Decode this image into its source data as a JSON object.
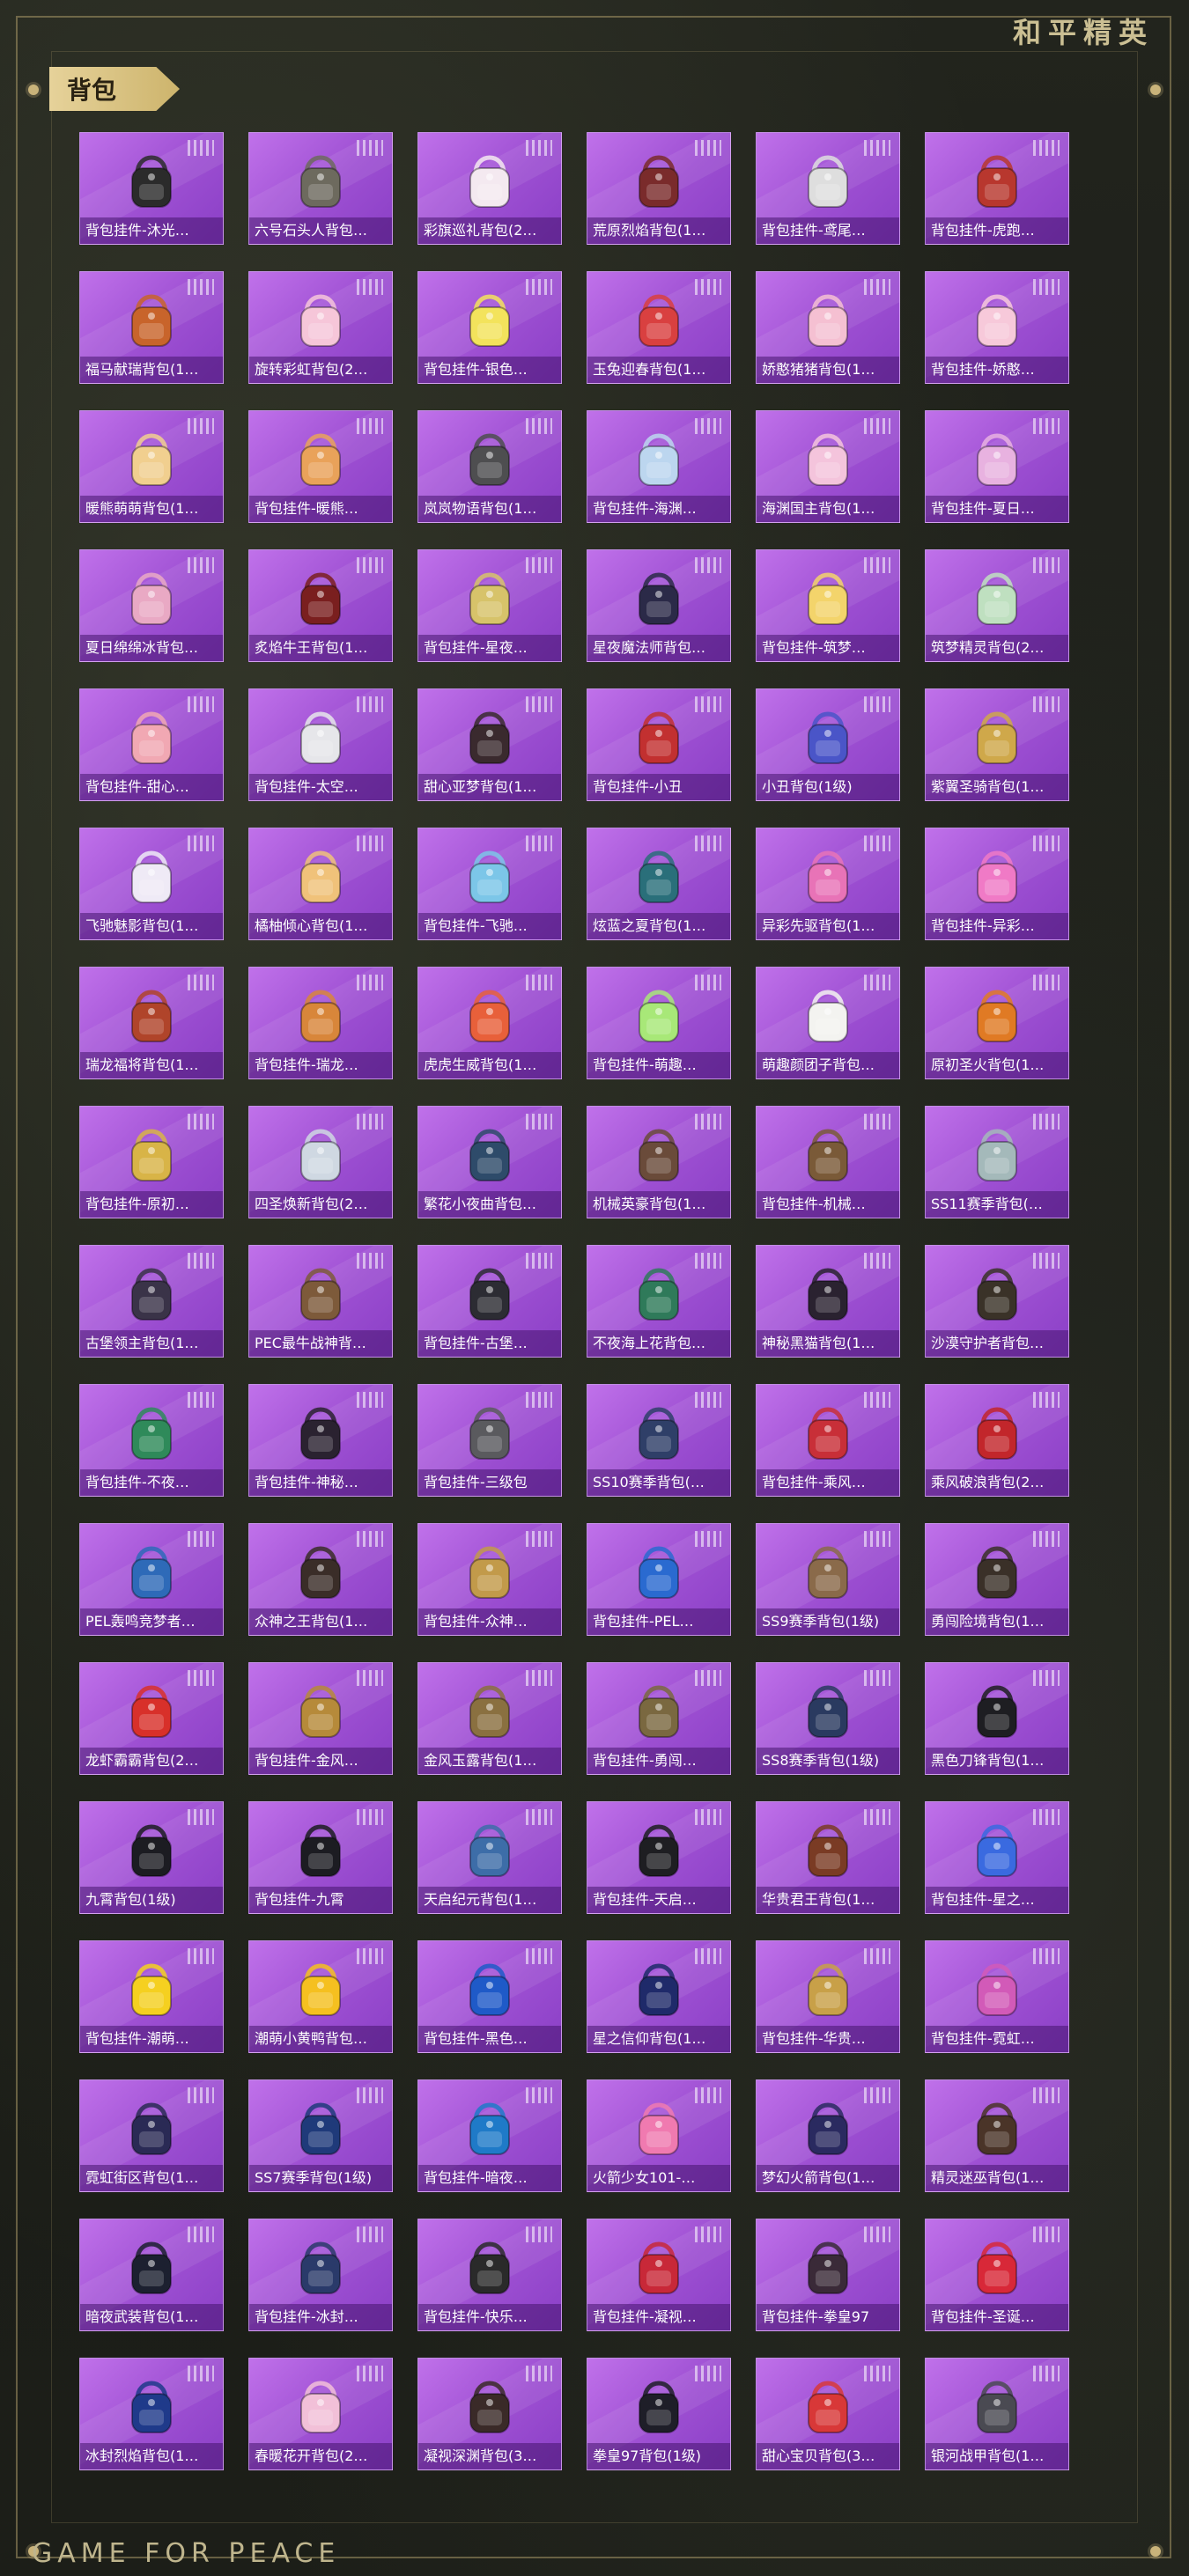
{
  "header": {
    "brand": "和平精英"
  },
  "section": {
    "title": "背包"
  },
  "footer": {
    "brand": "GAME FOR PEACE"
  },
  "items": [
    {
      "label": "背包挂件-沐光…",
      "color": "#2b2b2b"
    },
    {
      "label": "六号石头人背包…",
      "color": "#6d6a5e"
    },
    {
      "label": "彩旗巡礼背包(2…",
      "color": "#f4e9f0"
    },
    {
      "label": "荒原烈焰背包(1…",
      "color": "#7a2b2b"
    },
    {
      "label": "背包挂件-鸢尾…",
      "color": "#dedede"
    },
    {
      "label": "背包挂件-虎跑…",
      "color": "#b8372e"
    },
    {
      "label": "福马献瑞背包(1…",
      "color": "#c8642b"
    },
    {
      "label": "旋转彩虹背包(2…",
      "color": "#f6c6d9"
    },
    {
      "label": "背包挂件-银色…",
      "color": "#f3e35c"
    },
    {
      "label": "玉兔迎春背包(1…",
      "color": "#d94040"
    },
    {
      "label": "娇憨猪猪背包(1…",
      "color": "#f5c0d2"
    },
    {
      "label": "背包挂件-娇憨…",
      "color": "#f7c9da"
    },
    {
      "label": "暖熊萌萌背包(1…",
      "color": "#f1cf8f"
    },
    {
      "label": "背包挂件-暖熊…",
      "color": "#e9a25a"
    },
    {
      "label": "岚岚物语背包(1…",
      "color": "#4e4e50"
    },
    {
      "label": "背包挂件-海渊…",
      "color": "#bcd6ef"
    },
    {
      "label": "海渊国主背包(1…",
      "color": "#f4c4dc"
    },
    {
      "label": "背包挂件-夏日…",
      "color": "#e8b2e0"
    },
    {
      "label": "夏日绵绵冰背包…",
      "color": "#e9a9c4"
    },
    {
      "label": "炙焰牛王背包(1…",
      "color": "#7a1f1f"
    },
    {
      "label": "背包挂件-星夜…",
      "color": "#d7c36a"
    },
    {
      "label": "星夜魔法师背包…",
      "color": "#2b2a48"
    },
    {
      "label": "背包挂件-筑梦…",
      "color": "#f3d46b"
    },
    {
      "label": "筑梦精灵背包(2…",
      "color": "#bfe0c0"
    },
    {
      "label": "背包挂件-甜心…",
      "color": "#f1a8b3"
    },
    {
      "label": "背包挂件-太空…",
      "color": "#e6e6ea"
    },
    {
      "label": "甜心亚梦背包(1…",
      "color": "#3a2a2e"
    },
    {
      "label": "背包挂件-小丑",
      "color": "#c23030"
    },
    {
      "label": "小丑背包(1级)",
      "color": "#4a55c8"
    },
    {
      "label": "紫翼圣骑背包(1…",
      "color": "#cfa84a"
    },
    {
      "label": "飞驰魅影背包(1…",
      "color": "#efeaf6"
    },
    {
      "label": "橘柚倾心背包(1…",
      "color": "#f0c27a"
    },
    {
      "label": "背包挂件-飞驰…",
      "color": "#7cc6e8"
    },
    {
      "label": "炫蓝之夏背包(1…",
      "color": "#2a6f7a"
    },
    {
      "label": "异彩先驱背包(1…",
      "color": "#e873b7"
    },
    {
      "label": "背包挂件-异彩…",
      "color": "#f07ac6"
    },
    {
      "label": "瑞龙福将背包(1…",
      "color": "#b0442a"
    },
    {
      "label": "背包挂件-瑞龙…",
      "color": "#d8863a"
    },
    {
      "label": "虎虎生威背包(1…",
      "color": "#e8603a"
    },
    {
      "label": "背包挂件-萌趣…",
      "color": "#a8e878"
    },
    {
      "label": "萌趣颜团子背包…",
      "color": "#f3f3f0"
    },
    {
      "label": "原初圣火背包(1…",
      "color": "#e07a24"
    },
    {
      "label": "背包挂件-原初…",
      "color": "#d8b447"
    },
    {
      "label": "四圣焕新背包(2…",
      "color": "#cfd8e2"
    },
    {
      "label": "繁花小夜曲背包…",
      "color": "#2e4b6a"
    },
    {
      "label": "机械英豪背包(1…",
      "color": "#6a4b3a"
    },
    {
      "label": "背包挂件-机械…",
      "color": "#7a5a38"
    },
    {
      "label": "SS11赛季背包(…",
      "color": "#a4b9ba"
    },
    {
      "label": "古堡领主背包(1…",
      "color": "#3a3348"
    },
    {
      "label": "PEC最牛战神背…",
      "color": "#7d5a3a"
    },
    {
      "label": "背包挂件-古堡…",
      "color": "#2c2c33"
    },
    {
      "label": "不夜海上花背包…",
      "color": "#2f7a5a"
    },
    {
      "label": "神秘黑猫背包(1…",
      "color": "#2a2230"
    },
    {
      "label": "沙漠守护者背包…",
      "color": "#3a3228"
    },
    {
      "label": "背包挂件-不夜…",
      "color": "#2f8a5a"
    },
    {
      "label": "背包挂件-神秘…",
      "color": "#2a2230"
    },
    {
      "label": "背包挂件-三级包",
      "color": "#5a5a5e"
    },
    {
      "label": "SS10赛季背包(…",
      "color": "#2f3f68"
    },
    {
      "label": "背包挂件-乘风…",
      "color": "#c82f38"
    },
    {
      "label": "乘风破浪背包(2…",
      "color": "#c2262b"
    },
    {
      "label": "PEL轰鸣竞梦者…",
      "color": "#2e6ab8"
    },
    {
      "label": "众神之王背包(1…",
      "color": "#3a2d28"
    },
    {
      "label": "背包挂件-众神…",
      "color": "#c29a4a"
    },
    {
      "label": "背包挂件-PEL…",
      "color": "#2a6ad0"
    },
    {
      "label": "SS9赛季背包(1级)",
      "color": "#8a6a4a"
    },
    {
      "label": "勇闯险境背包(1…",
      "color": "#3a3028"
    },
    {
      "label": "龙虾霸霸背包(2…",
      "color": "#d8302a"
    },
    {
      "label": "背包挂件-金风…",
      "color": "#b68a3a"
    },
    {
      "label": "金风玉露背包(1…",
      "color": "#8a7040"
    },
    {
      "label": "背包挂件-勇闯…",
      "color": "#7a6840"
    },
    {
      "label": "SS8赛季背包(1级)",
      "color": "#2a3a60"
    },
    {
      "label": "黑色刀锋背包(1…",
      "color": "#1e1e22"
    },
    {
      "label": "九霄背包(1级)",
      "color": "#1c1c22"
    },
    {
      "label": "背包挂件-九霄",
      "color": "#1c1c22"
    },
    {
      "label": "天启纪元背包(1…",
      "color": "#3d6da8"
    },
    {
      "label": "背包挂件-天启…",
      "color": "#1e1e22"
    },
    {
      "label": "华贵君王背包(1…",
      "color": "#7a3b24"
    },
    {
      "label": "背包挂件-星之…",
      "color": "#3a6ae0"
    },
    {
      "label": "背包挂件-潮萌…",
      "color": "#f5d020"
    },
    {
      "label": "潮萌小黄鸭背包…",
      "color": "#f5c020"
    },
    {
      "label": "背包挂件-黑色…",
      "color": "#1f5ac8"
    },
    {
      "label": "星之信仰背包(1…",
      "color": "#1f2a6a"
    },
    {
      "label": "背包挂件-华贵…",
      "color": "#c8a048"
    },
    {
      "label": "背包挂件-霓虹…",
      "color": "#d25ab8"
    },
    {
      "label": "霓虹街区背包(1…",
      "color": "#2a2a55"
    },
    {
      "label": "SS7赛季背包(1级)",
      "color": "#1f3a7a"
    },
    {
      "label": "背包挂件-暗夜…",
      "color": "#1f7ac8"
    },
    {
      "label": "火箭少女101-…",
      "color": "#f07ab0"
    },
    {
      "label": "梦幻火箭背包(1…",
      "color": "#2a2a60"
    },
    {
      "label": "精灵迷巫背包(1…",
      "color": "#4a3428"
    },
    {
      "label": "暗夜武装背包(1…",
      "color": "#1c2030"
    },
    {
      "label": "背包挂件-冰封…",
      "color": "#2a3a6a"
    },
    {
      "label": "背包挂件-快乐…",
      "color": "#2a2a2a"
    },
    {
      "label": "背包挂件-凝视…",
      "color": "#c82838"
    },
    {
      "label": "背包挂件-拳皇97",
      "color": "#3a2a38"
    },
    {
      "label": "背包挂件-圣诞…",
      "color": "#d82838"
    },
    {
      "label": "冰封烈焰背包(1…",
      "color": "#1f3a8a"
    },
    {
      "label": "春暖花开背包(2…",
      "color": "#f2c0d8"
    },
    {
      "label": "凝视深渊背包(3…",
      "color": "#3a2a28"
    },
    {
      "label": "拳皇97背包(1级)",
      "color": "#1e1e28"
    },
    {
      "label": "甜心宝贝背包(3…",
      "color": "#d83838"
    },
    {
      "label": "银河战甲背包(1…",
      "color": "#4a4a52"
    }
  ]
}
